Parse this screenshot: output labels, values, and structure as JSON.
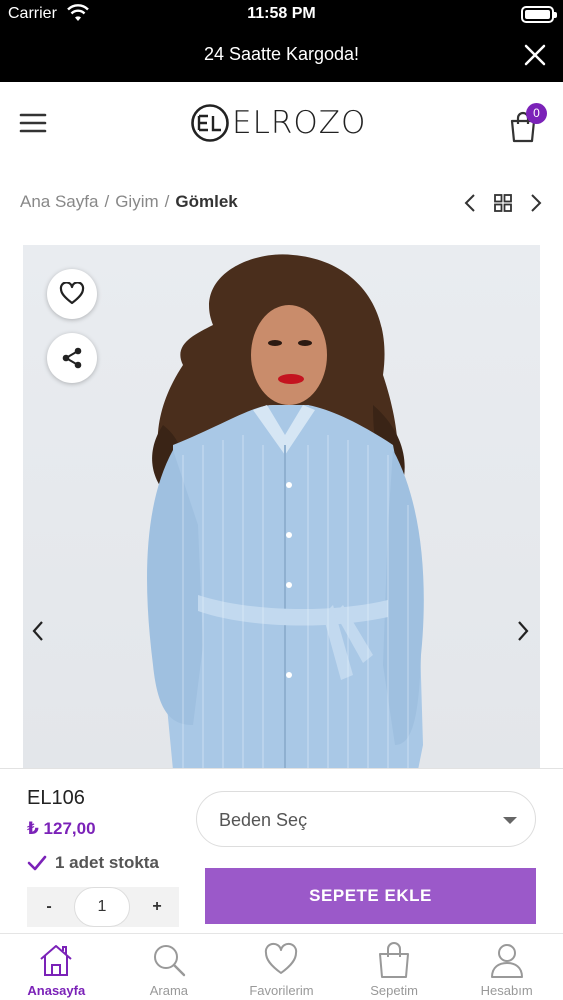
{
  "status_bar": {
    "carrier": "Carrier",
    "time": "11:58 PM"
  },
  "announcement": {
    "text": "24 Saatte Kargoda!"
  },
  "header": {
    "brand": "ELRОZO",
    "cart_count": "0"
  },
  "breadcrumb": {
    "items": [
      "Ana Sayfa",
      "Giyim"
    ],
    "separator": "/",
    "current": "Gömlek"
  },
  "product": {
    "code": "EL106",
    "price": "₺ 127,00",
    "stock": "1 adet stokta",
    "quantity": "1",
    "minus_label": "-",
    "plus_label": "+",
    "size_placeholder": "Beden Seç",
    "add_to_cart": "SEPETE EKLE"
  },
  "tabs": [
    {
      "label": "Anasayfa",
      "icon": "home-icon",
      "active": true
    },
    {
      "label": "Arama",
      "icon": "search-icon",
      "active": false
    },
    {
      "label": "Favorilerim",
      "icon": "heart-icon",
      "active": false
    },
    {
      "label": "Sepetim",
      "icon": "bag-icon",
      "active": false
    },
    {
      "label": "Hesabım",
      "icon": "user-icon",
      "active": false
    }
  ],
  "colors": {
    "accent": "#7b22b8",
    "button": "#9b59c9",
    "black_bar": "#000000"
  }
}
